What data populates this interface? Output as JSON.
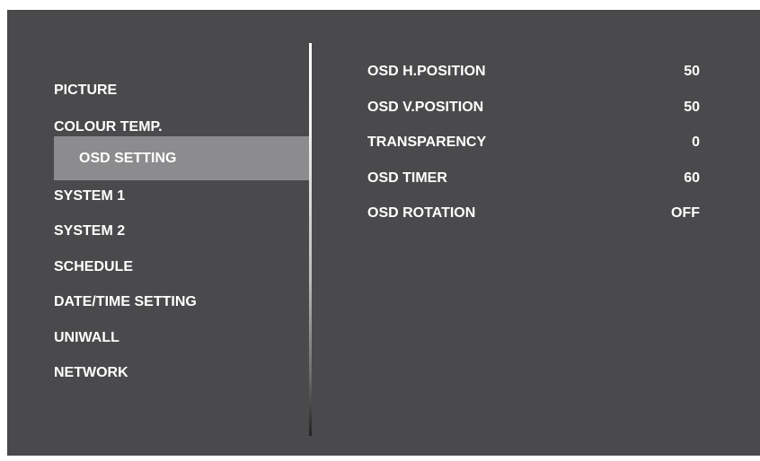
{
  "colors": {
    "background": "#4a4a4c",
    "selected_highlight": "#8c8c8e",
    "text": "#ffffff"
  },
  "menu": {
    "items": [
      {
        "label": "PICTURE"
      },
      {
        "label": "COLOUR TEMP."
      },
      {
        "label": "OSD SETTING",
        "selected": true
      },
      {
        "label": "SYSTEM 1"
      },
      {
        "label": "SYSTEM 2"
      },
      {
        "label": "SCHEDULE"
      },
      {
        "label": "DATE/TIME SETTING"
      },
      {
        "label": "UNIWALL"
      },
      {
        "label": "NETWORK"
      }
    ]
  },
  "settings": {
    "rows": [
      {
        "label": "OSD H.POSITION",
        "value": "50"
      },
      {
        "label": "OSD V.POSITION",
        "value": "50"
      },
      {
        "label": "TRANSPARENCY",
        "value": "0"
      },
      {
        "label": "OSD TIMER",
        "value": "60"
      },
      {
        "label": "OSD ROTATION",
        "value": "OFF"
      }
    ]
  }
}
